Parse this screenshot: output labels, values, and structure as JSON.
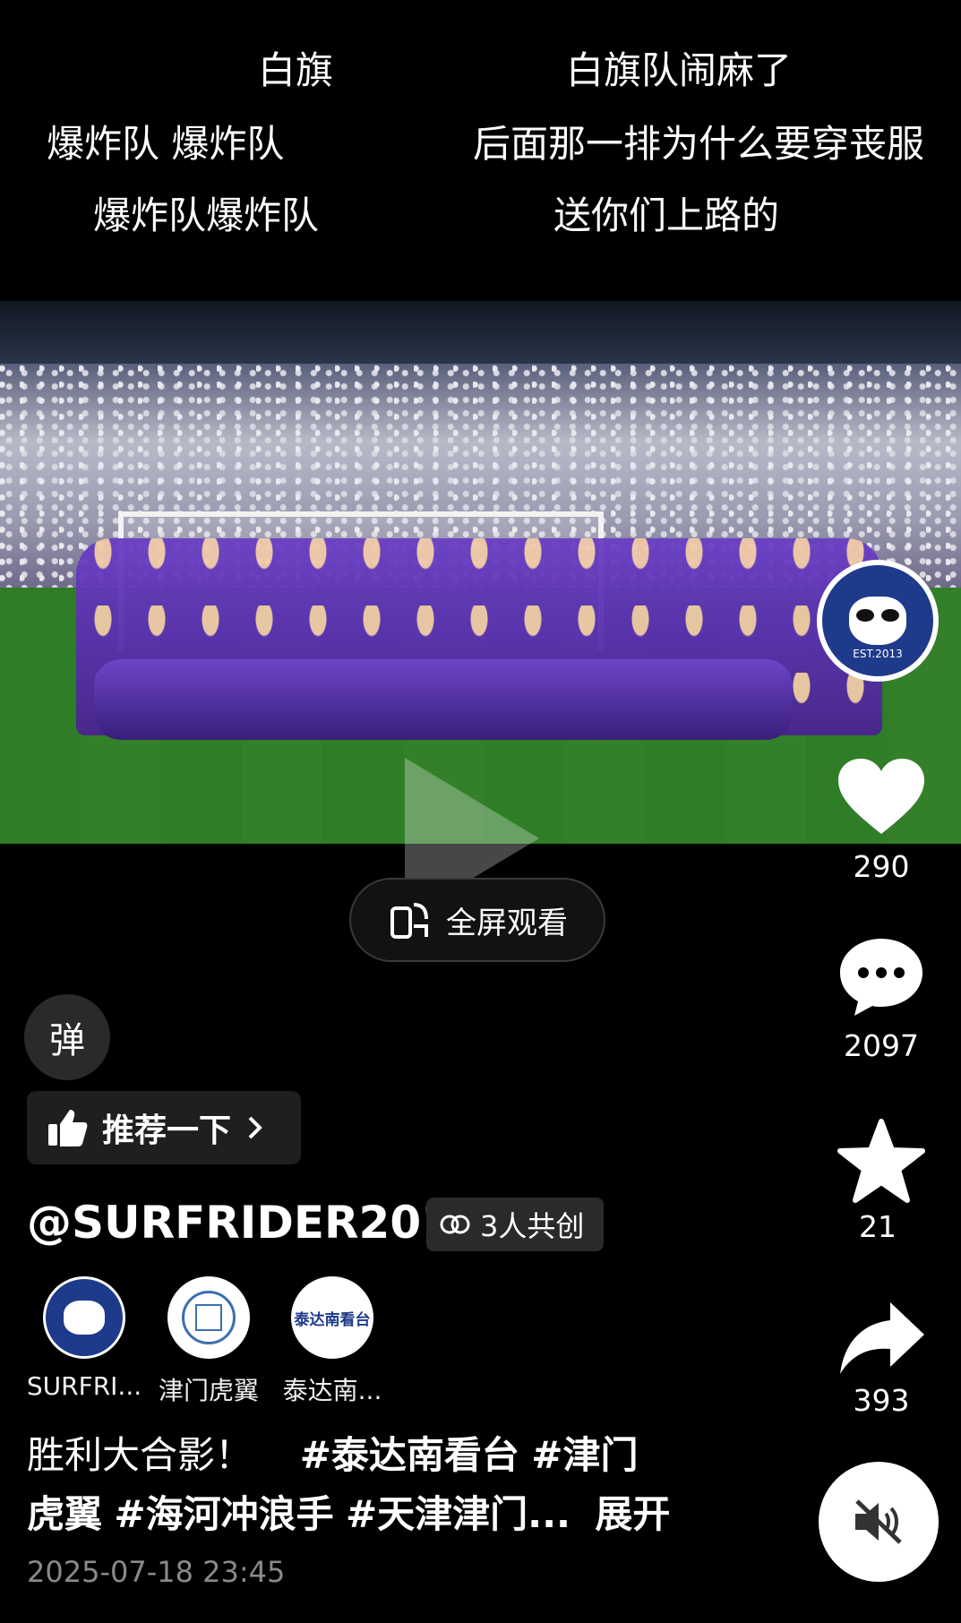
{
  "danmaku": [
    "白旗",
    "白旗队闹麻了",
    "爆炸队 爆炸队",
    "后面那一排为什么要穿丧服",
    "爆炸队爆炸队",
    "送你们上路的"
  ],
  "badge": {
    "est_text": "EST.2013"
  },
  "rail": {
    "likes": "290",
    "comments": "2097",
    "favorites": "21",
    "shares": "393"
  },
  "fullscreen": {
    "label": "全屏观看"
  },
  "danmu_toggle": {
    "label": "弹"
  },
  "recommend": {
    "label": "推荐一下"
  },
  "author": {
    "handle": "@SURFRIDER2013"
  },
  "cocreate": {
    "label": "3人共创"
  },
  "creators": [
    {
      "name": "SURFRI...",
      "avatar_text": ""
    },
    {
      "name": "津门虎翼",
      "avatar_text": ""
    },
    {
      "name": "泰达南...",
      "avatar_text": "泰达南看台"
    }
  ],
  "caption": {
    "text": "胜利大合影！",
    "tags": [
      "#泰达南看台",
      "#津门虎翼",
      "#海河冲浪手",
      "#天津津门..."
    ],
    "expand": "展开"
  },
  "date": "2025-07-18 23:45",
  "colors": {
    "background": "#000000",
    "team_purple": "#5a2fb0",
    "badge_blue": "#1e3a8a"
  }
}
